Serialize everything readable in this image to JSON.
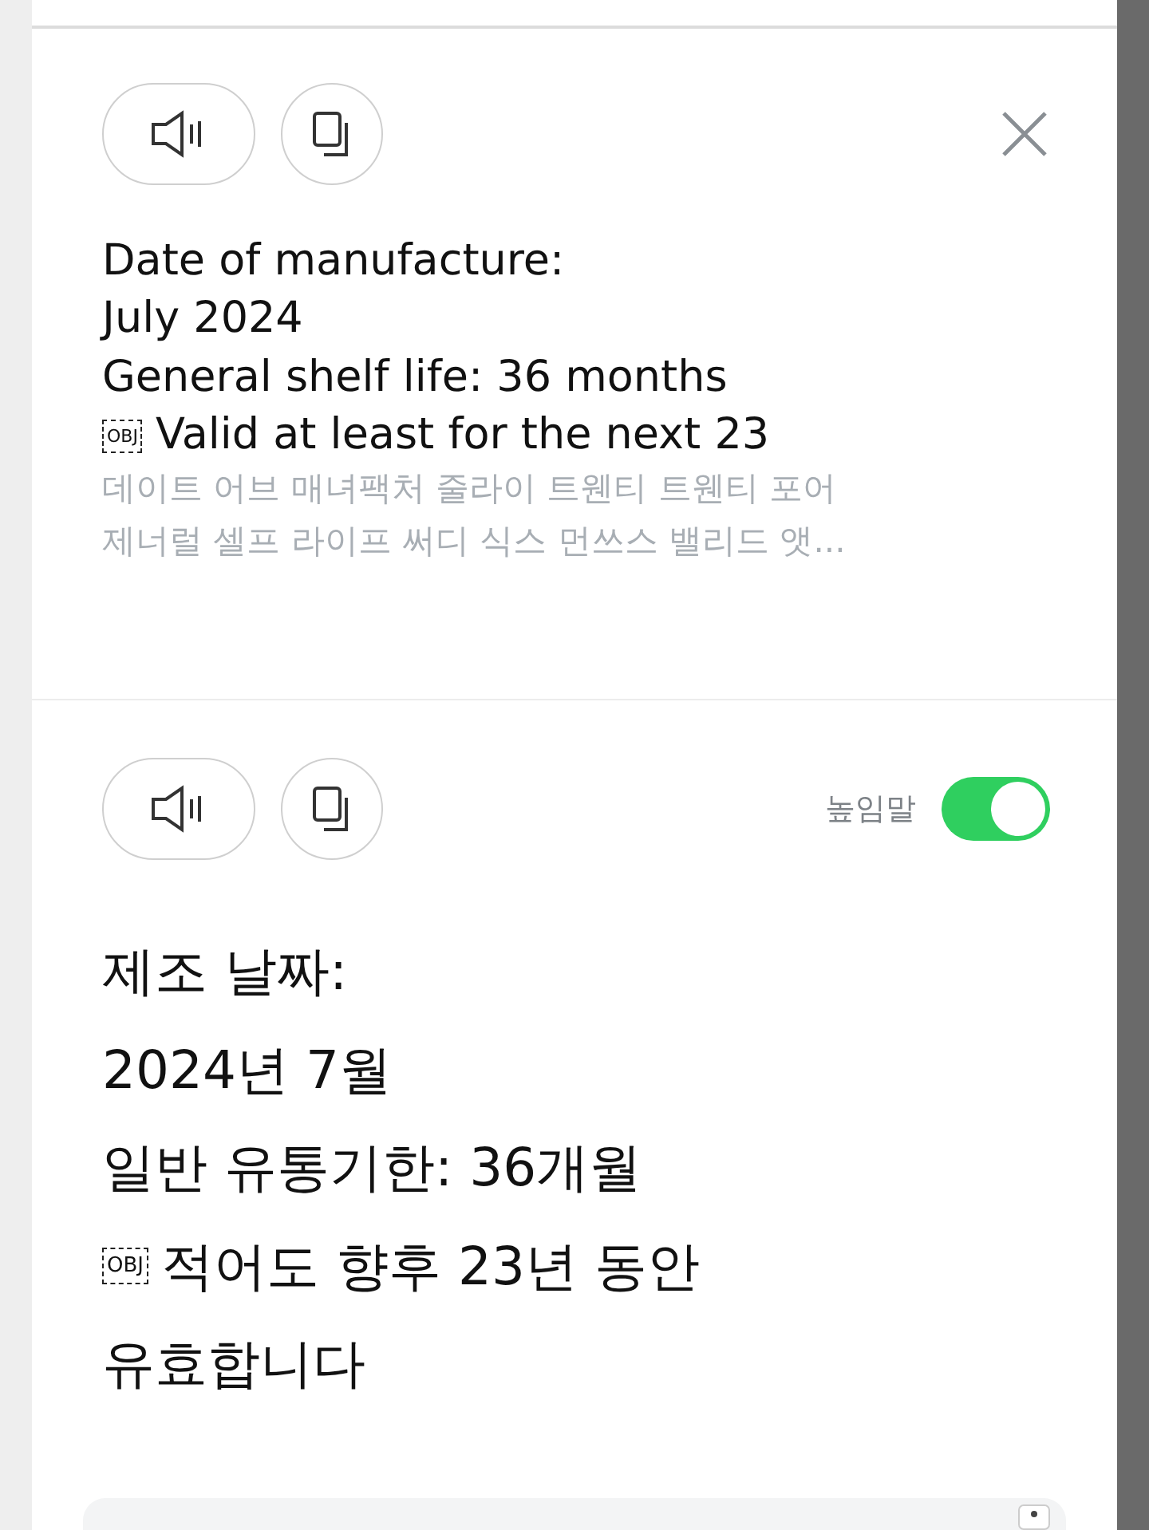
{
  "source": {
    "lines": [
      {
        "text": "Date of manufacture:"
      },
      {
        "text": "July 2024"
      },
      {
        "text": "General shelf life: 36 months"
      },
      {
        "marker": "OBJ",
        "text": "Valid at least for the next 23"
      }
    ],
    "pronunciation": [
      "데이트 어브 매녀팩처 줄라이 트웬티 트웬티 포어",
      "제너럴 셀프 라이프 써디 식스 먼쓰스 밸리드 앳..."
    ]
  },
  "target": {
    "honorific": {
      "label": "높임말",
      "on": true
    },
    "lines": [
      {
        "text": "제조 날짜:"
      },
      {
        "text": "2024년 7월"
      },
      {
        "text": "일반 유통기한: 36개월"
      },
      {
        "marker": "OBJ",
        "text": "적어도 향후 23년 동안"
      },
      {
        "text": "유효합니다"
      }
    ]
  }
}
